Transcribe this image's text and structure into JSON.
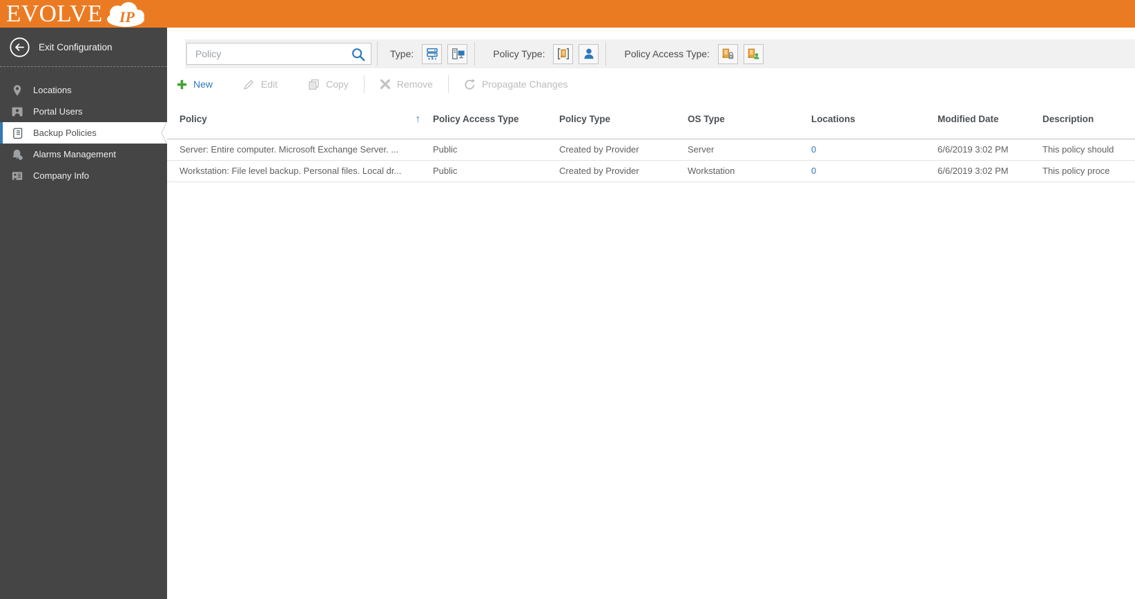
{
  "app": {
    "logo_text": "EVOLVE",
    "logo_badge": "IP",
    "colors": {
      "brand_orange": "#EB7B23",
      "sidebar_gray": "#454545",
      "accent_blue": "#2E79B9",
      "selected_border_blue": "#3379B7",
      "enabled_green": "#3EA231",
      "disabled_gray": "#bcbcbc",
      "scroll_gold": "#EAA83C",
      "badge_green": "#4CAF50"
    }
  },
  "sidebar": {
    "exit_label": "Exit Configuration",
    "exit_icon": "back-arrow-circle-icon",
    "items": [
      {
        "label": "Locations",
        "icon": "location-pin-icon",
        "selected": false
      },
      {
        "label": "Portal Users",
        "icon": "portal-user-icon",
        "selected": false
      },
      {
        "label": "Backup Policies",
        "icon": "policy-scroll-icon",
        "selected": true
      },
      {
        "label": "Alarms Management",
        "icon": "alarm-bell-gear-icon",
        "selected": false
      },
      {
        "label": "Company Info",
        "icon": "company-info-icon",
        "selected": false
      }
    ]
  },
  "filters": {
    "search": {
      "placeholder": "Policy",
      "value": "",
      "icon": "search-icon"
    },
    "groups": [
      {
        "label": "Type:",
        "icons": [
          "server-type-icon",
          "workstation-type-icon"
        ]
      },
      {
        "label": "Policy Type:",
        "icons": [
          "provider-policy-icon",
          "user-policy-icon"
        ]
      },
      {
        "label": "Policy Access Type:",
        "icons": [
          "private-policy-lock-icon",
          "public-policy-person-icon"
        ]
      }
    ]
  },
  "toolbar": {
    "buttons": [
      {
        "label": "New",
        "icon": "plus-icon",
        "enabled": true
      },
      {
        "label": "Edit",
        "icon": "pencil-icon",
        "enabled": false
      },
      {
        "label": "Copy",
        "icon": "copy-icon",
        "enabled": false
      },
      {
        "label": "Remove",
        "icon": "x-icon",
        "enabled": false
      },
      {
        "label": "Propagate Changes",
        "icon": "refresh-icon",
        "enabled": false
      }
    ]
  },
  "table": {
    "columns": [
      "Policy",
      "Policy Access Type",
      "Policy Type",
      "OS Type",
      "Locations",
      "Modified Date",
      "Description"
    ],
    "sort": {
      "column": "Policy",
      "direction": "ascending",
      "indicator": "↑"
    },
    "rows": [
      {
        "policy": "Server: Entire computer. Microsoft Exchange Server. ...",
        "policy_access_type": "Public",
        "policy_type": "Created by Provider",
        "os_type": "Server",
        "locations": "0",
        "modified_date": "6/6/2019 3:02 PM",
        "description": "This policy should"
      },
      {
        "policy": "Workstation: File level backup. Personal files. Local dr...",
        "policy_access_type": "Public",
        "policy_type": "Created by Provider",
        "os_type": "Workstation",
        "locations": "0",
        "modified_date": "6/6/2019 3:02 PM",
        "description": "This policy proce"
      }
    ]
  }
}
